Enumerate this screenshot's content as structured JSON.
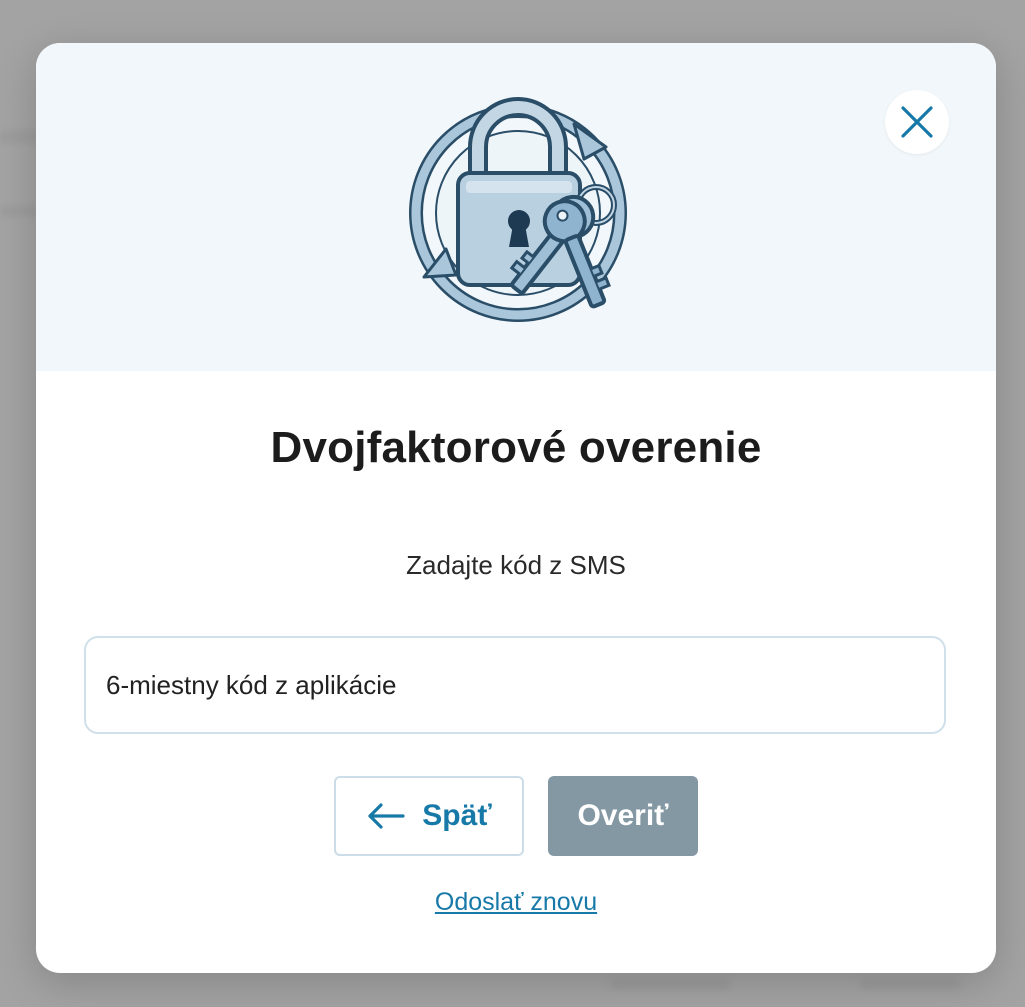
{
  "dialog": {
    "title": "Dvojfaktorové overenie",
    "subtitle": "Zadajte kód z SMS",
    "illustration_icon": "padlock-with-keys-icon",
    "close_icon": "close-icon"
  },
  "code_input": {
    "placeholder": "6-miestny kód z aplikácie",
    "value": ""
  },
  "actions": {
    "back_label": "Späť",
    "back_icon": "arrow-left-icon",
    "verify_label": "Overiť",
    "resend_label": "Odoslať znovu"
  },
  "colors": {
    "accent": "#1779a8",
    "verify_disabled": "#8498a4",
    "header_bg": "#f1f7fa",
    "backdrop": "#a3a3a3"
  }
}
